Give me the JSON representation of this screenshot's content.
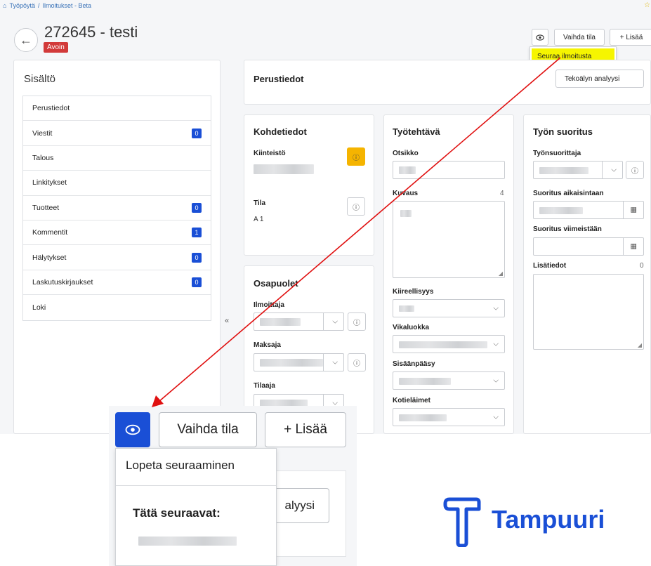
{
  "breadcrumb": {
    "home": "Työpöytä",
    "sep": "/",
    "section": "Ilmoitukset - Beta"
  },
  "header": {
    "title": "272645 - testi",
    "status": "Avoin"
  },
  "toolbar": {
    "change_state": "Vaihda tila",
    "add": "+ Lisää",
    "follow_menu_item": "Seuraa ilmoitusta",
    "analysis_btn": "Tekoälyn analyysi"
  },
  "sidebar": {
    "title": "Sisältö",
    "collapse": "«",
    "items": [
      {
        "label": "Perustiedot",
        "count": null
      },
      {
        "label": "Viestit",
        "count": "0"
      },
      {
        "label": "Talous",
        "count": null
      },
      {
        "label": "Linkitykset",
        "count": null
      },
      {
        "label": "Tuotteet",
        "count": "0"
      },
      {
        "label": "Kommentit",
        "count": "1"
      },
      {
        "label": "Hälytykset",
        "count": "0"
      },
      {
        "label": "Laskutuskirjaukset",
        "count": "0"
      },
      {
        "label": "Loki",
        "count": null
      }
    ]
  },
  "main": {
    "basic_title": "Perustiedot",
    "target": {
      "title": "Kohdetiedot",
      "property_label": "Kiinteistö",
      "space_label": "Tila",
      "space_value": "A 1"
    },
    "parties": {
      "title": "Osapuolet",
      "reporter_label": "Ilmoittaja",
      "payer_label": "Maksaja",
      "orderer_label": "Tilaaja"
    },
    "task": {
      "title": "Työtehtävä",
      "subject_label": "Otsikko",
      "desc_label": "Kuvaus",
      "desc_count": "4",
      "urgency_label": "Kiireellisyys",
      "fault_label": "Vikaluokka",
      "access_label": "Sisäänpääsy",
      "pets_label": "Kotieläimet"
    },
    "execution": {
      "title": "Työn suoritus",
      "worker_label": "Työnsuorittaja",
      "earliest_label": "Suoritus aikaisintaan",
      "latest_label": "Suoritus viimeistään",
      "extra_label": "Lisätiedot",
      "extra_count": "0"
    }
  },
  "zoom": {
    "change_state": "Vaihda tila",
    "add": "+ Lisää",
    "unfollow": "Lopeta seuraaminen",
    "followers_heading": "Tätä seuraavat:",
    "analysis_fragment": "alyysi"
  },
  "logo": {
    "text": "Tampuuri"
  },
  "colors": {
    "accent": "#1a4fd6",
    "status_red": "#d23a3a",
    "highlight": "#f6f500",
    "annotation": "#e01010",
    "warn": "#f5b400"
  },
  "icons": {
    "eye": "eye-icon",
    "info": "info-icon",
    "calendar": "calendar-icon",
    "chevron": "chevron-down-icon",
    "back": "arrow-left-icon",
    "home": "home-icon"
  }
}
